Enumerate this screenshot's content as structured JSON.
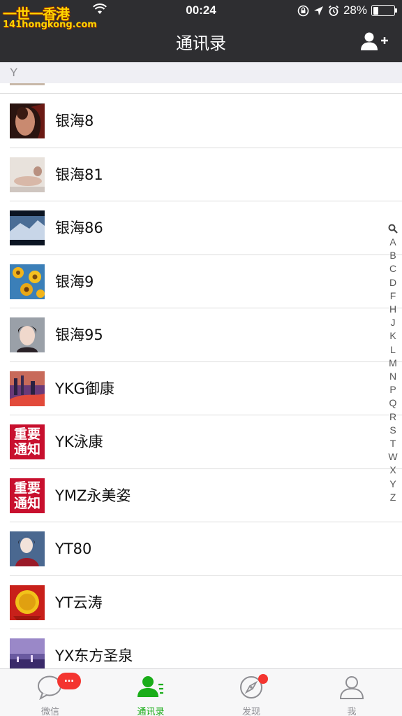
{
  "status_bar": {
    "watermark_title": "一世一香港",
    "watermark_site": "141hongkong.com",
    "time": "00:24",
    "battery": "28%",
    "battery_level": 0.28
  },
  "nav": {
    "title": "通讯录",
    "add_icon": "add-contact-icon"
  },
  "section_letter": "Y",
  "contacts": [
    {
      "name": "银海8",
      "avatar": "photo-portrait-dark"
    },
    {
      "name": "银海81",
      "avatar": "photo-reclining"
    },
    {
      "name": "银海86",
      "avatar": "photo-landscape-blue"
    },
    {
      "name": "银海9",
      "avatar": "photo-sunflowers"
    },
    {
      "name": "银海95",
      "avatar": "photo-girl"
    },
    {
      "name": "YKG御康",
      "avatar": "photo-city-night"
    },
    {
      "name": "YK泳康",
      "avatar": "notice-red",
      "notice_text": [
        "重要",
        "通知"
      ]
    },
    {
      "name": "YMZ永美姿",
      "avatar": "notice-red",
      "notice_text": [
        "重要",
        "通知"
      ]
    },
    {
      "name": "YT80",
      "avatar": "photo-portrait-light"
    },
    {
      "name": "YT云涛",
      "avatar": "photo-gold-emblem"
    },
    {
      "name": "YX东方圣泉",
      "avatar": "photo-purple-sky"
    }
  ],
  "index_letters": [
    "A",
    "B",
    "C",
    "D",
    "F",
    "H",
    "J",
    "K",
    "L",
    "M",
    "N",
    "P",
    "Q",
    "R",
    "S",
    "T",
    "W",
    "X",
    "Y",
    "Z"
  ],
  "tabs": [
    {
      "label": "微信",
      "icon": "chat-bubble-icon",
      "badge": "…"
    },
    {
      "label": "通讯录",
      "icon": "contacts-icon",
      "active": true
    },
    {
      "label": "发现",
      "icon": "compass-icon",
      "dot": true
    },
    {
      "label": "我",
      "icon": "person-icon"
    }
  ],
  "colors": {
    "nav_bg": "#2e2e31",
    "accent_green": "#1aad19",
    "badge_red": "#f43530"
  }
}
